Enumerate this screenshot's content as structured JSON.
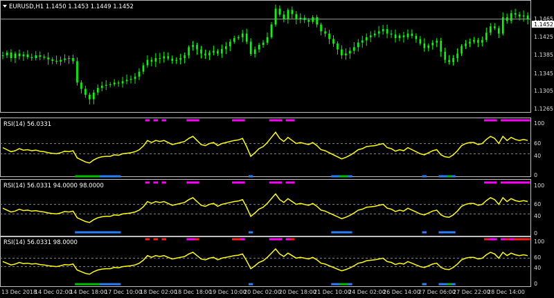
{
  "symbol_header": "EURUSD,H1  1.1450 1.1453 1.1449 1.1452",
  "price_axis": {
    "ticks": [
      "1.1465",
      "1.1425",
      "1.1385",
      "1.1345",
      "1.1305",
      "1.1265"
    ],
    "current": "1.1452"
  },
  "indicator_axis": {
    "ticks": [
      "100",
      "60",
      "40",
      "0"
    ]
  },
  "panels": [
    {
      "label": "RSI(14) 56.0331"
    },
    {
      "label": "RSI(14) 56.0331 94.0000 98.0000"
    },
    {
      "label": "RSI(14) 56.0331 98.0000"
    }
  ],
  "time_axis": [
    "13 Dec 2018",
    "14 Dec 02:00",
    "14 Dec 18:00",
    "17 Dec 10:00",
    "18 Dec 02:00",
    "18 Dec 18:00",
    "19 Dec 10:00",
    "20 Dec 02:00",
    "20 Dec 18:00",
    "21 Dec 10:00",
    "24 Dec 02:00",
    "26 Dec 14:00",
    "27 Dec 06:00",
    "27 Dec 22:00",
    "28 Dec 14:00"
  ],
  "chart_data": {
    "type": "line",
    "price": {
      "ylim": [
        1.125,
        1.1485
      ],
      "current": 1.1452,
      "closes": [
        1.1372,
        1.1378,
        1.1366,
        1.1376,
        1.137,
        1.1374,
        1.1368,
        1.1366,
        1.1372,
        1.1369,
        1.1367,
        1.1363,
        1.136,
        1.1358,
        1.1362,
        1.1365,
        1.1366,
        1.1359,
        1.1312,
        1.1298,
        1.1285,
        1.1275,
        1.129,
        1.13,
        1.1305,
        1.1307,
        1.1308,
        1.1312,
        1.131,
        1.1315,
        1.1318,
        1.132,
        1.1325,
        1.1336,
        1.135,
        1.1362,
        1.1358,
        1.1366,
        1.1365,
        1.137,
        1.1365,
        1.136,
        1.1362,
        1.1366,
        1.1372,
        1.139,
        1.1395,
        1.1385,
        1.1376,
        1.1372,
        1.1378,
        1.1382,
        1.1376,
        1.1386,
        1.1392,
        1.1402,
        1.141,
        1.1412,
        1.142,
        1.1402,
        1.1375,
        1.1385,
        1.1395,
        1.14,
        1.1412,
        1.144,
        1.1475,
        1.1462,
        1.1452,
        1.1472,
        1.1463,
        1.1452,
        1.1455,
        1.145,
        1.1446,
        1.1456,
        1.144,
        1.1425,
        1.142,
        1.1408,
        1.1398,
        1.1385,
        1.1372,
        1.1376,
        1.1382,
        1.139,
        1.14,
        1.1405,
        1.1412,
        1.1416,
        1.142,
        1.1425,
        1.143,
        1.142,
        1.1418,
        1.141,
        1.1416,
        1.1412,
        1.142,
        1.1415,
        1.1408,
        1.1398,
        1.1388,
        1.1394,
        1.14,
        1.1404,
        1.138,
        1.1362,
        1.1357,
        1.1366,
        1.1376,
        1.1392,
        1.1398,
        1.1402,
        1.1406,
        1.14,
        1.1406,
        1.1422,
        1.1436,
        1.1432,
        1.142,
        1.1456,
        1.1448,
        1.1465,
        1.1462,
        1.1458,
        1.146,
        1.1452
      ]
    },
    "rsi": {
      "ylim": [
        0,
        100
      ],
      "levels": [
        40,
        60
      ],
      "values": [
        52,
        48,
        44,
        46,
        50,
        47,
        48,
        46,
        47,
        45,
        44,
        42,
        41,
        40,
        42,
        45,
        44,
        46,
        32,
        28,
        24,
        22,
        28,
        32,
        34,
        35,
        35,
        38,
        37,
        40,
        41,
        42,
        44,
        48,
        55,
        66,
        62,
        66,
        64,
        66,
        62,
        58,
        60,
        62,
        64,
        70,
        74,
        66,
        58,
        56,
        60,
        62,
        56,
        60,
        62,
        64,
        66,
        67,
        70,
        54,
        35,
        42,
        50,
        54,
        62,
        72,
        82,
        70,
        64,
        72,
        66,
        60,
        62,
        60,
        58,
        62,
        56,
        48,
        46,
        42,
        38,
        34,
        30,
        33,
        37,
        42,
        48,
        50,
        54,
        55,
        56,
        58,
        60,
        52,
        50,
        45,
        48,
        46,
        52,
        48,
        44,
        40,
        38,
        42,
        46,
        48,
        38,
        34,
        33,
        38,
        46,
        56,
        60,
        62,
        62,
        58,
        60,
        68,
        74,
        70,
        60,
        74,
        66,
        72,
        68,
        66,
        68,
        66
      ]
    },
    "marker_colors": {
      "upper": "#ff00ff",
      "upper_alt": "#ff2020",
      "lower": "#2b7fff",
      "lower_alt": "#00c000"
    },
    "candle_color": "#00ff00",
    "rsi_color": "#ffff00"
  }
}
